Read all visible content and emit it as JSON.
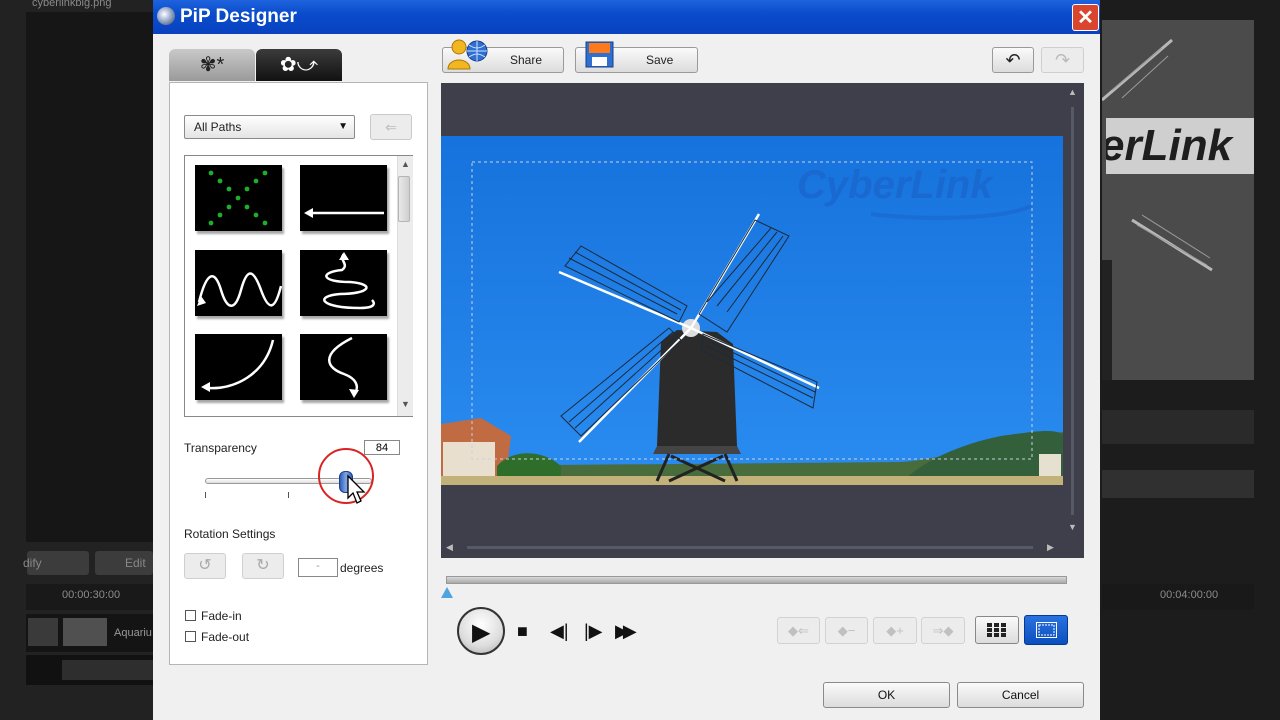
{
  "background_app": {
    "left_file_label": "cyberlinkbig.png",
    "modify_button": "dify",
    "edit_button": "Edit",
    "ruler_time_left": "00:00:30:00",
    "ruler_time_right": "00:04:00:00",
    "clip_label": "Aquariu",
    "right_preview_logo": "erLink"
  },
  "window": {
    "title": "PiP Designer",
    "close_glyph": "✕"
  },
  "tabs": [
    {
      "label": "✾*",
      "icon": "objects-tab-icon"
    },
    {
      "label": "✿⤻",
      "icon": "motion-tab-icon"
    }
  ],
  "motion_panel": {
    "path_filter": {
      "value": "All Paths",
      "arrow": "▼"
    },
    "import_glyph": "⇐",
    "path_thumbnails": [
      "x-path",
      "right-to-left-line",
      "wave",
      "spiral-squiggle",
      "curve-up-left",
      "s-curve-down"
    ],
    "transparency": {
      "label": "Transparency",
      "value": "84",
      "level": 84
    },
    "rotation": {
      "label": "Rotation Settings",
      "degrees_value": "-",
      "degrees_label": "degrees",
      "ccw_glyph": "↺",
      "cw_glyph": "↻"
    },
    "fade_in": {
      "label": "Fade-in",
      "checked": false
    },
    "fade_out": {
      "label": "Fade-out",
      "checked": false
    }
  },
  "toolbar": {
    "share_label": "Share",
    "save_label": "Save",
    "undo_glyph": "↶",
    "redo_glyph": "↷"
  },
  "preview": {
    "watermark": "CyberLink",
    "colors": {
      "sky": "#1e7be0",
      "dark_bg": "#3e3f4a",
      "accent": "#0b4fbf",
      "highlight": "#d92424"
    }
  },
  "playback": {
    "controls": {
      "play": "▶",
      "stop": "■",
      "prev_frame": "◀|",
      "next_frame": "|▶",
      "fast_forward": "▶▶"
    },
    "keyframe_buttons": [
      "◆⇐",
      "◆−",
      "◆+",
      "⇒◆"
    ]
  },
  "dialog_buttons": {
    "ok": "OK",
    "cancel": "Cancel"
  }
}
